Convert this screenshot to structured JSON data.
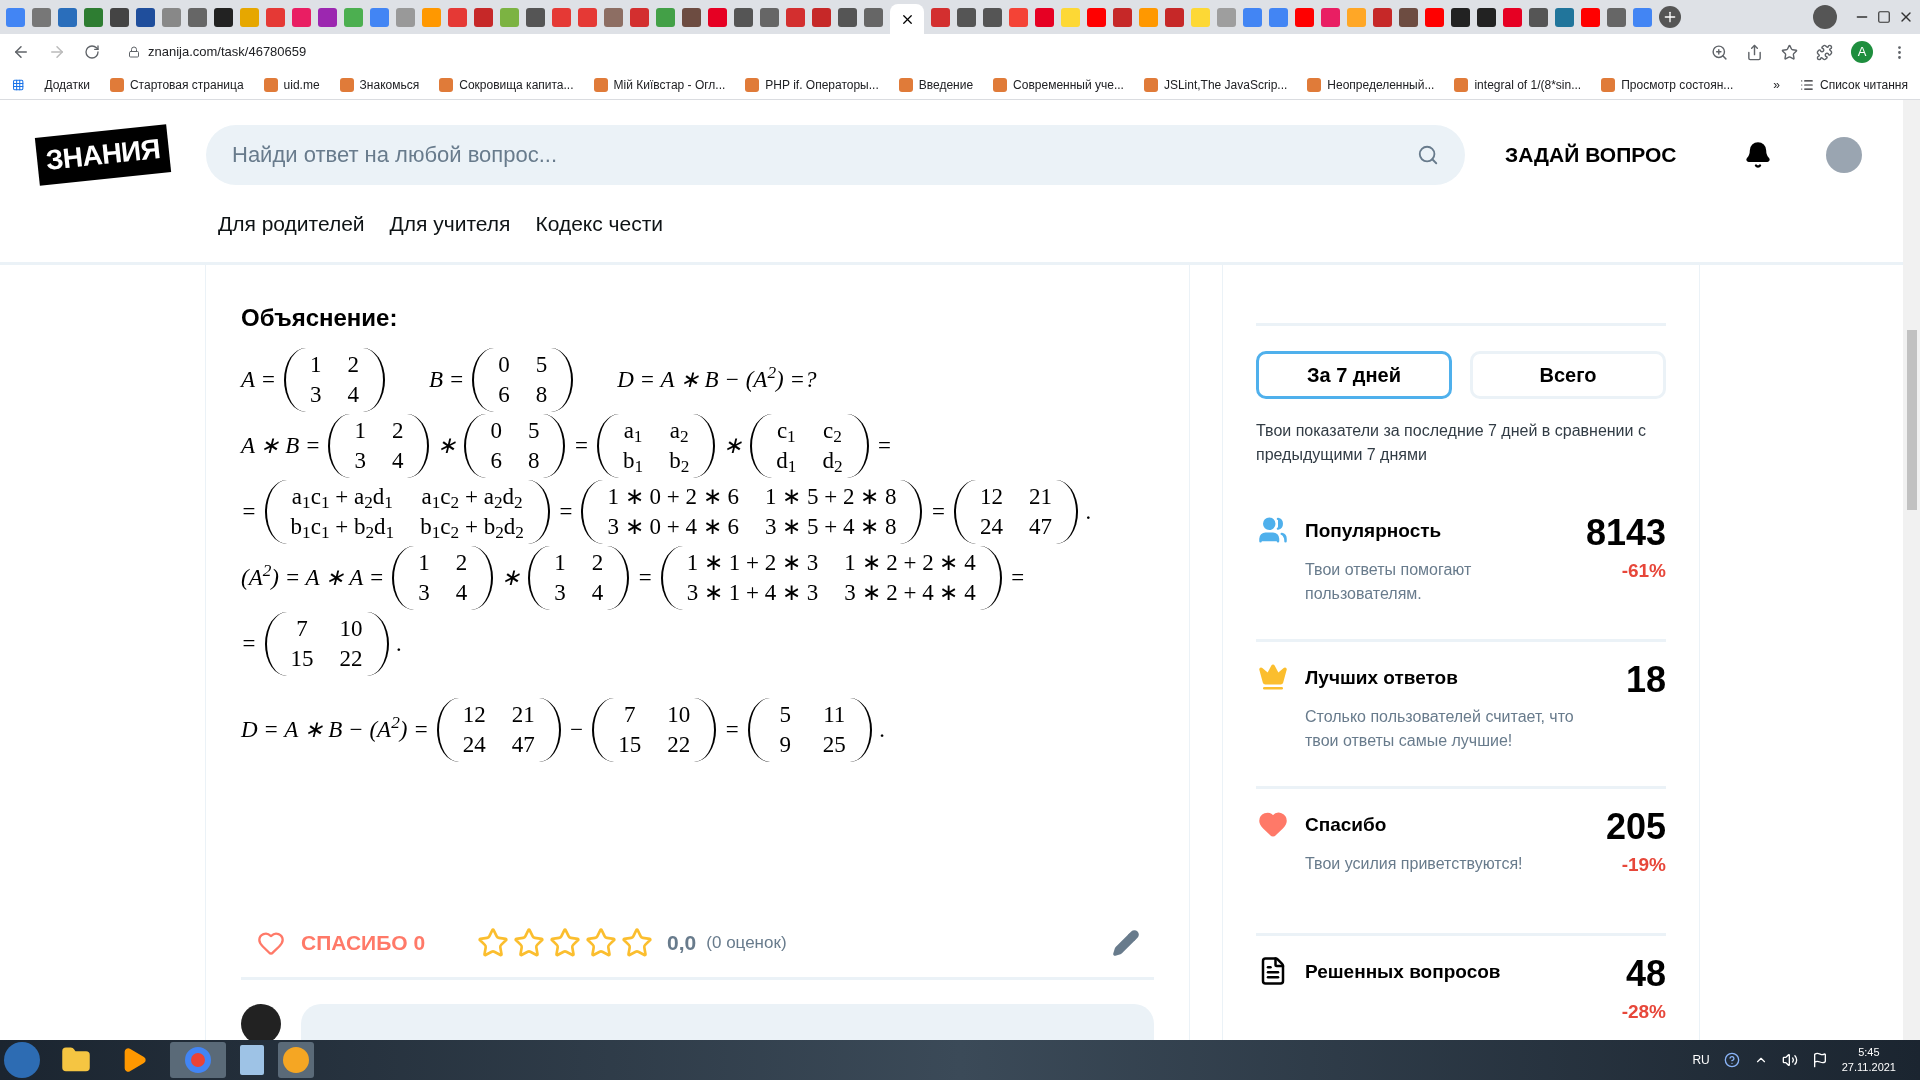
{
  "browser": {
    "url": "znanija.com/task/46780659",
    "profile_initial": "A",
    "bookmarks": [
      "Додатки",
      "Стартовая страница",
      "uid.me",
      "Знакомься",
      "Сокровища капита...",
      "Мій Київстар - Огл...",
      "PHP if. Операторы...",
      "Введение",
      "Современный уче...",
      "JSLint,The JavaScrip...",
      "Неопределенный...",
      "integral of 1/(8*sin...",
      "Просмотр состоян..."
    ],
    "bookmarks_more": "»",
    "reading_list": "Список читання"
  },
  "header": {
    "logo": "ЗНАНИЯ",
    "search": {
      "placeholder": "Найди ответ на любой вопрос..."
    },
    "ask_button": "ЗАДАЙ ВОПРОС"
  },
  "nav": [
    "Для родителей",
    "Для учителя",
    "Кодекс чести"
  ],
  "answer": {
    "heading": "Объяснение:",
    "math_lines": [
      [
        {
          "kind": "text",
          "text": "A ="
        },
        {
          "kind": "matrix",
          "rows": [
            [
              "1",
              "2"
            ],
            [
              "3",
              "4"
            ]
          ]
        },
        {
          "kind": "gap"
        },
        {
          "kind": "text",
          "text": "B ="
        },
        {
          "kind": "matrix",
          "rows": [
            [
              "0",
              "5"
            ],
            [
              "6",
              "8"
            ]
          ]
        },
        {
          "kind": "gap"
        },
        {
          "kind": "text",
          "text": "D = A ∗ B − (A$^{2}$) =?"
        }
      ],
      [
        {
          "kind": "text",
          "text": "A ∗ B ="
        },
        {
          "kind": "matrix",
          "rows": [
            [
              "1",
              "2"
            ],
            [
              "3",
              "4"
            ]
          ]
        },
        {
          "kind": "text",
          "text": "∗"
        },
        {
          "kind": "matrix",
          "rows": [
            [
              "0",
              "5"
            ],
            [
              "6",
              "8"
            ]
          ]
        },
        {
          "kind": "text",
          "text": "="
        },
        {
          "kind": "matrix",
          "rows": [
            [
              "a$_{1}$",
              "a$_{2}$"
            ],
            [
              "b$_{1}$",
              "b$_{2}$"
            ]
          ]
        },
        {
          "kind": "text",
          "text": "∗"
        },
        {
          "kind": "matrix",
          "rows": [
            [
              "c$_{1}$",
              "c$_{2}$"
            ],
            [
              "d$_{1}$",
              "d$_{2}$"
            ]
          ]
        },
        {
          "kind": "text",
          "text": "="
        }
      ],
      [
        {
          "kind": "text",
          "text": "="
        },
        {
          "kind": "matrix",
          "rows": [
            [
              "a$_{1}$c$_{1}$ + a$_{2}$d$_{1}$",
              "a$_{1}$c$_{2}$ + a$_{2}$d$_{2}$"
            ],
            [
              "b$_{1}$c$_{1}$ + b$_{2}$d$_{1}$",
              "b$_{1}$c$_{2}$ + b$_{2}$d$_{2}$"
            ]
          ]
        },
        {
          "kind": "text",
          "text": "="
        },
        {
          "kind": "matrix",
          "rows": [
            [
              "1 ∗ 0 + 2 ∗ 6",
              "1 ∗ 5 + 2 ∗ 8"
            ],
            [
              "3 ∗ 0 + 4 ∗ 6",
              "3 ∗ 5 + 4 ∗ 8"
            ]
          ]
        },
        {
          "kind": "text",
          "text": "="
        },
        {
          "kind": "matrix",
          "rows": [
            [
              "12",
              "21"
            ],
            [
              "24",
              "47"
            ]
          ]
        },
        {
          "kind": "text",
          "text": "."
        }
      ],
      [
        {
          "kind": "text",
          "text": "(A$^{2}$) = A ∗ A ="
        },
        {
          "kind": "matrix",
          "rows": [
            [
              "1",
              "2"
            ],
            [
              "3",
              "4"
            ]
          ]
        },
        {
          "kind": "text",
          "text": "∗"
        },
        {
          "kind": "matrix",
          "rows": [
            [
              "1",
              "2"
            ],
            [
              "3",
              "4"
            ]
          ]
        },
        {
          "kind": "text",
          "text": "="
        },
        {
          "kind": "matrix",
          "rows": [
            [
              "1 ∗ 1 + 2 ∗ 3",
              "1 ∗ 2 + 2 ∗ 4"
            ],
            [
              "3 ∗ 1 + 4 ∗ 3",
              "3 ∗ 2 + 4 ∗ 4"
            ]
          ]
        },
        {
          "kind": "text",
          "text": "="
        }
      ],
      [
        {
          "kind": "text",
          "text": "="
        },
        {
          "kind": "matrix",
          "rows": [
            [
              "7",
              "10"
            ],
            [
              "15",
              "22"
            ]
          ]
        },
        {
          "kind": "text",
          "text": "."
        }
      ],
      [
        {
          "kind": "text",
          "text": "D = A ∗ B − (A$^{2}$) ="
        },
        {
          "kind": "matrix",
          "rows": [
            [
              "12",
              "21"
            ],
            [
              "24",
              "47"
            ]
          ]
        },
        {
          "kind": "text",
          "text": "−"
        },
        {
          "kind": "matrix",
          "rows": [
            [
              "7",
              "10"
            ],
            [
              "15",
              "22"
            ]
          ]
        },
        {
          "kind": "text",
          "text": "="
        },
        {
          "kind": "matrix",
          "rows": [
            [
              "5",
              "11"
            ],
            [
              "9",
              "25"
            ]
          ]
        },
        {
          "kind": "text",
          "text": "."
        }
      ]
    ],
    "thanks": "СПАСИБО 0",
    "stars": 0,
    "rating": "0,0",
    "rating_count": "(0 оценок)"
  },
  "stats": {
    "tabs": [
      {
        "label": "За 7 дней",
        "selected": true
      },
      {
        "label": "Всего",
        "selected": false
      }
    ],
    "intro": "Твои показатели за последние 7 дней в сравнении с предыдущими 7 днями",
    "items": [
      {
        "kind": "people",
        "title": "Популярность",
        "value": "8143",
        "description": "Твои ответы помогают пользователям.",
        "change": "-61%"
      },
      {
        "kind": "crown",
        "title": "Лучших ответов",
        "value": "18",
        "description": "Столько пользователей считает, что твои ответы самые лучшие!"
      },
      {
        "kind": "heart",
        "title": "Спасибо",
        "value": "205",
        "description": "Твои усилия приветствуются!",
        "change": "-19%"
      },
      {
        "kind": "document",
        "title": "Решенных вопросов",
        "value": "48",
        "change": "-28%"
      }
    ]
  },
  "taskbar": {
    "language": "RU",
    "time": "5:45",
    "date": "27.11.2021"
  }
}
